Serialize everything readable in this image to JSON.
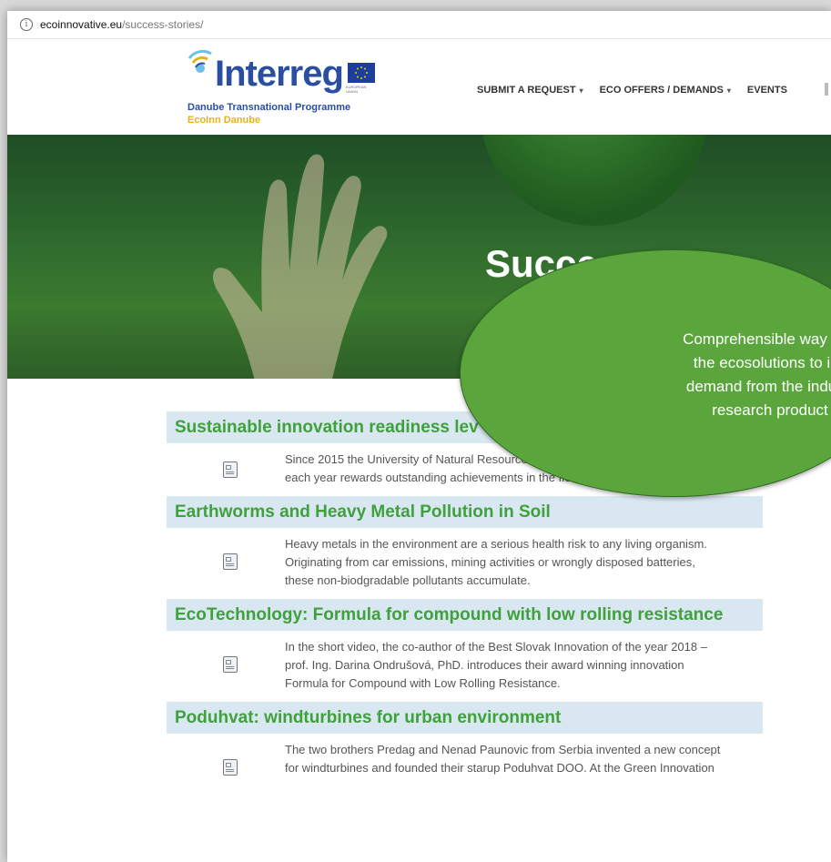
{
  "browser": {
    "url_host": "ecoinnovative.eu",
    "url_path": "/success-stories/"
  },
  "logo": {
    "word": "Interreg",
    "eu_text": "EUROPEAN UNION",
    "subtitle": "Danube Transnational Programme",
    "project": "EcoInn Danube"
  },
  "nav": {
    "items": [
      {
        "label": "SUBMIT A REQUEST",
        "caret": "▾"
      },
      {
        "label": "ECO OFFERS / DEMANDS",
        "caret": "▾"
      },
      {
        "label": "EVENTS",
        "caret": ""
      }
    ]
  },
  "hero": {
    "title": "Succes"
  },
  "callout": {
    "lines": [
      "Comprehensible way of e",
      "the ecosolutions to inc",
      "demand from the industr",
      "research product"
    ]
  },
  "stories": [
    {
      "title": "Sustainable innovation readiness lev",
      "body": [
        "Since 2015 the University of Natural Resources ar",
        "each year rewards outstanding achievements in the field o"
      ]
    },
    {
      "title": "Earthworms and Heavy Metal Pollution in Soil",
      "body": [
        "Heavy metals in the environment are a serious health risk to any living organism.",
        "Originating from car emissions, mining activities or wrongly disposed batteries,",
        "these non-biodgradable pollutants accumulate."
      ]
    },
    {
      "title": "EcoTechnology: Formula for compound with low rolling resistance",
      "body": [
        "In the short video, the co-author of the Best Slovak Innovation of the year 2018 –",
        "prof. Ing. Darina Ondrušová, PhD. introduces their award winning innovation",
        "Formula for Compound with Low Rolling Resistance."
      ]
    },
    {
      "title": "Poduhvat: windturbines for urban environment",
      "body": [
        "The two brothers Predag and Nenad Paunovic from Serbia invented a new concept",
        "for windturbines and founded their starup Poduhvat DOO. At the Green Innovation",
        ""
      ]
    }
  ],
  "colors": {
    "brand_blue": "#2a4ea2",
    "brand_yellow": "#e7b31d",
    "story_title": "#3fa13b",
    "story_bg": "#d9e7f1",
    "callout": "#5aa63c"
  }
}
